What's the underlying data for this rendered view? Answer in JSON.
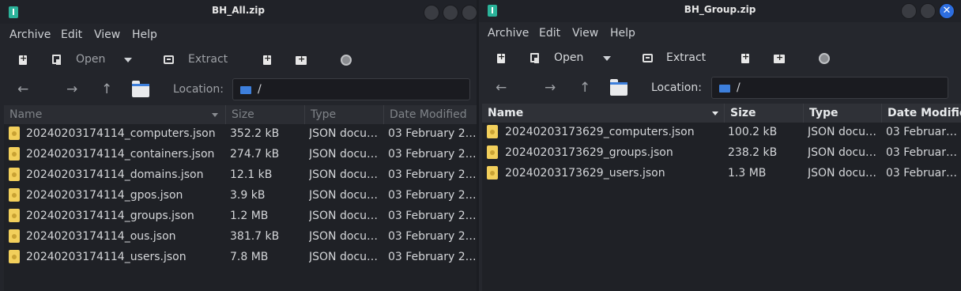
{
  "window_left": {
    "title": "BH_All.zip",
    "menu": [
      "Archive",
      "Edit",
      "View",
      "Help"
    ],
    "toolbar": {
      "open_label": "Open",
      "extract_label": "Extract"
    },
    "location": {
      "label": "Location:",
      "path": "/"
    },
    "columns": [
      "Name",
      "Size",
      "Type",
      "Date Modified"
    ],
    "files": [
      {
        "name": "20240203174114_computers.json",
        "size": "352.2 kB",
        "type": "JSON docu…",
        "date": "03 February 2…"
      },
      {
        "name": "20240203174114_containers.json",
        "size": "274.7 kB",
        "type": "JSON docu…",
        "date": "03 February 2…"
      },
      {
        "name": "20240203174114_domains.json",
        "size": "12.1 kB",
        "type": "JSON docu…",
        "date": "03 February 2…"
      },
      {
        "name": "20240203174114_gpos.json",
        "size": "3.9 kB",
        "type": "JSON docu…",
        "date": "03 February 2…"
      },
      {
        "name": "20240203174114_groups.json",
        "size": "1.2 MB",
        "type": "JSON docu…",
        "date": "03 February 2…"
      },
      {
        "name": "20240203174114_ous.json",
        "size": "381.7 kB",
        "type": "JSON docu…",
        "date": "03 February 2…"
      },
      {
        "name": "20240203174114_users.json",
        "size": "7.8 MB",
        "type": "JSON docu…",
        "date": "03 February 2…"
      }
    ]
  },
  "window_right": {
    "title": "BH_Group.zip",
    "close_glyph": "✕",
    "menu": [
      "Archive",
      "Edit",
      "View",
      "Help"
    ],
    "toolbar": {
      "open_label": "Open",
      "extract_label": "Extract"
    },
    "location": {
      "label": "Location:",
      "path": "/"
    },
    "columns": [
      "Name",
      "Size",
      "Type",
      "Date Modifie"
    ],
    "files": [
      {
        "name": "20240203173629_computers.json",
        "size": "100.2 kB",
        "type": "JSON docu…",
        "date": "03 Februar…"
      },
      {
        "name": "20240203173629_groups.json",
        "size": "238.2 kB",
        "type": "JSON docu…",
        "date": "03 Februar…"
      },
      {
        "name": "20240203173629_users.json",
        "size": "1.3 MB",
        "type": "JSON docu…",
        "date": "03 Februar…"
      }
    ]
  },
  "colors": {
    "accent": "#2d6ee0",
    "folder_blue": "#3d7fdc",
    "json_icon": "#f2cf5b",
    "app_icon": "#2bb39a"
  },
  "icons": [
    "app-icon",
    "new-archive-icon",
    "open-icon",
    "extract-icon",
    "add-files-icon",
    "add-folder-icon",
    "record-icon",
    "back-arrow-icon",
    "forward-arrow-icon",
    "up-arrow-icon",
    "folder-icon",
    "json-file-icon"
  ]
}
